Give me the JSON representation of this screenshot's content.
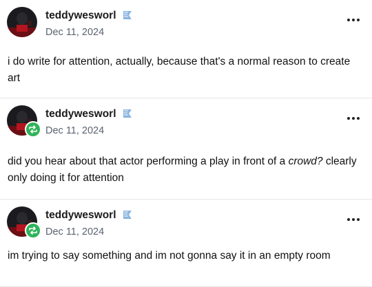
{
  "posts": [
    {
      "username": "teddywesworl",
      "date": "Dec 11, 2024",
      "reblogged": false,
      "text": "i do write for attention, actually, because that's a normal reason to create art"
    },
    {
      "username": "teddywesworl",
      "date": "Dec 11, 2024",
      "reblogged": true,
      "text_before": "did you hear about that actor performing a play in front of a ",
      "text_italic": "crowd?",
      "text_after": " clearly only doing it for attention"
    },
    {
      "username": "teddywesworl",
      "date": "Dec 11, 2024",
      "reblogged": true,
      "text": "im trying to say something and im not gonna say it in an empty room"
    }
  ],
  "icons": {
    "pin": "pin-icon",
    "reblog": "reblog-icon",
    "more": "more-options-icon"
  },
  "colors": {
    "reblog_green": "#2fb35a",
    "pin_blue": "#8ab4e0",
    "date_gray": "#5a6270"
  }
}
